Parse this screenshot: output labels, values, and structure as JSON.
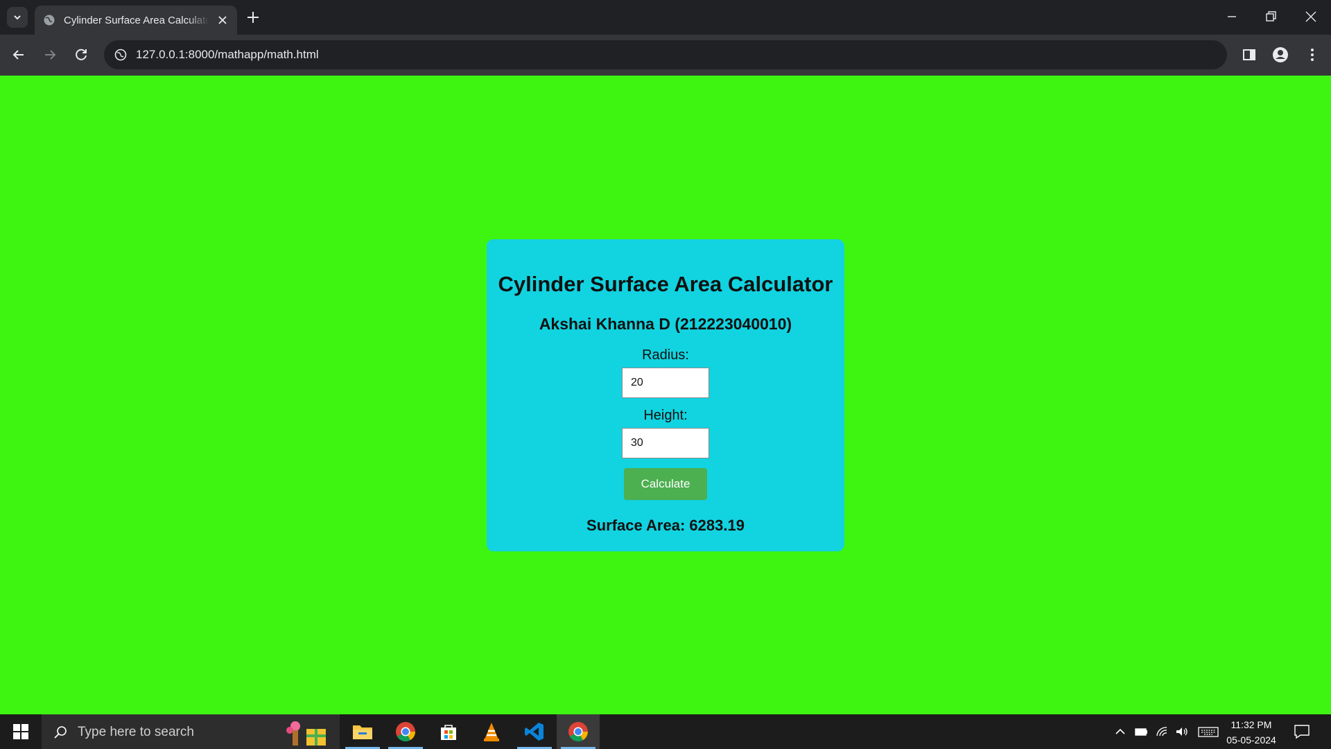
{
  "browser": {
    "tab_title": "Cylinder Surface Area Calculator",
    "url": "127.0.0.1:8000/mathapp/math.html"
  },
  "page": {
    "title": "Cylinder Surface Area Calculator",
    "author": "Akshai Khanna D (212223040010)",
    "radius_label": "Radius:",
    "radius_value": "20",
    "height_label": "Height:",
    "height_value": "30",
    "calculate_label": "Calculate",
    "result": "Surface Area: 6283.19"
  },
  "colors": {
    "page_background": "#3df510",
    "card_background": "#12d3e0",
    "button_background": "#4caf50"
  },
  "taskbar": {
    "search_placeholder": "Type here to search",
    "time": "11:32 PM",
    "date": "05-05-2024",
    "apps": [
      "file-explorer-icon",
      "chrome-icon",
      "microsoft-store-icon",
      "vlc-icon",
      "vscode-icon",
      "chrome-icon"
    ]
  }
}
